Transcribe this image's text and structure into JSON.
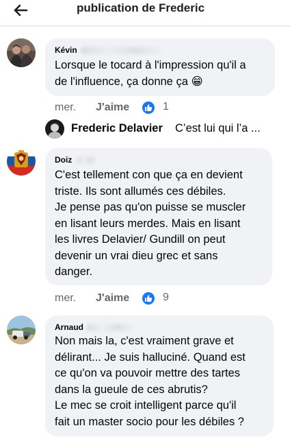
{
  "header": {
    "title": "publication de Frederic"
  },
  "comments": [
    {
      "author": "Kévin",
      "lines": [
        "Lorsque le tocard à l'impression qu'il a",
        "de l'influence, ça donne ça 😁"
      ],
      "time": "mer.",
      "like_label": "J'aime",
      "reactions": "1",
      "reply": {
        "author": "Frederic Delavier",
        "snippet": "C’est lui qui l’a ..."
      }
    },
    {
      "author": "Doiz",
      "lines": [
        "C'est tellement con que ça en devient",
        "triste. Ils sont allumés ces débiles.",
        "Je pense pas qu'on puisse se muscler",
        "en lisant leurs merdes. Mais en lisant",
        "les livres Delavier/ Gundill on peut",
        "devenir un vrai dieu grec et sans",
        "danger."
      ],
      "time": "mer.",
      "like_label": "J'aime",
      "reactions": "9"
    },
    {
      "author": "Arnaud",
      "lines": [
        "Non mais la, c'est vraiment grave et",
        "délirant... Je suis halluciné. Quand est",
        "ce qu'on va pouvoir mettre des tartes",
        "dans la gueule de ces abrutis?",
        "Le mec se croit intelligent parce qu'il",
        "fait un master socio pour les débiles ?"
      ]
    }
  ],
  "icons": {
    "back": "arrow-left-icon",
    "reaction": "thumbs-up-icon"
  },
  "colors": {
    "bubble": "#f0f2f5",
    "like_blue": "#1877f2",
    "meta_gray": "#65676b"
  }
}
